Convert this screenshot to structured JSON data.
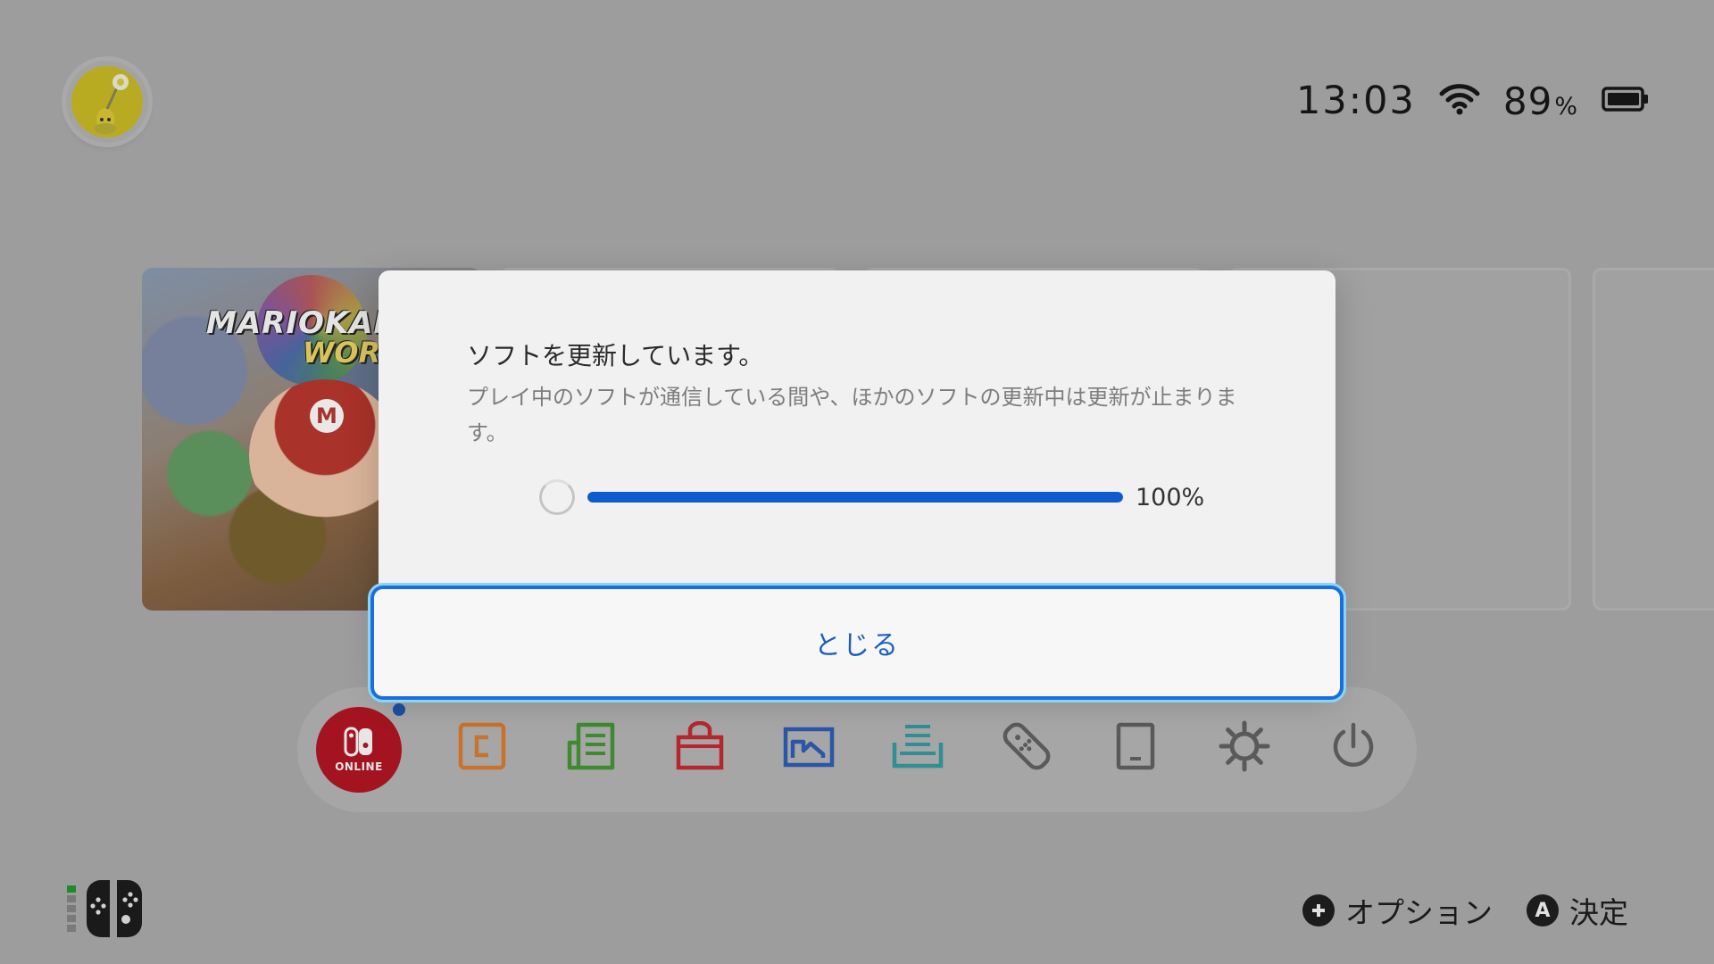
{
  "status": {
    "time": "13:03",
    "battery_value": "89",
    "battery_unit": "%"
  },
  "game": {
    "logo_line1": "MARIOKART",
    "logo_line2": "WORLD",
    "cap_letter": "M"
  },
  "dialog": {
    "title": "ソフトを更新しています。",
    "message": "プレイ中のソフトが通信している間や、ほかのソフトの更新中は更新が止まります。",
    "progress_percent": 100,
    "progress_label": "100%",
    "close_label": "とじる"
  },
  "menu": {
    "items": [
      {
        "label": "ONLINE",
        "icon": "nintendo-switch-online-icon",
        "color": "#a31420"
      },
      {
        "icon": "gamechat-icon",
        "color": "#c8722a"
      },
      {
        "icon": "news-icon",
        "color": "#3d8a2f"
      },
      {
        "icon": "eshop-icon",
        "color": "#b5272d"
      },
      {
        "icon": "album-icon",
        "color": "#2a56a8"
      },
      {
        "icon": "game-card-icon",
        "color": "#2f8f94"
      },
      {
        "icon": "controllers-icon",
        "color": "#5a5a5a"
      },
      {
        "icon": "tablet-icon",
        "color": "#5a5a5a"
      },
      {
        "icon": "settings-icon",
        "color": "#5a5a5a"
      },
      {
        "icon": "power-icon",
        "color": "#5a5a5a"
      }
    ],
    "notification_color": "#1d4f9f"
  },
  "footer": {
    "options_label": "オプション",
    "confirm_label": "決定",
    "confirm_button": "A"
  },
  "colors": {
    "accent": "#0e5bd0",
    "background": "#9d9d9d"
  }
}
